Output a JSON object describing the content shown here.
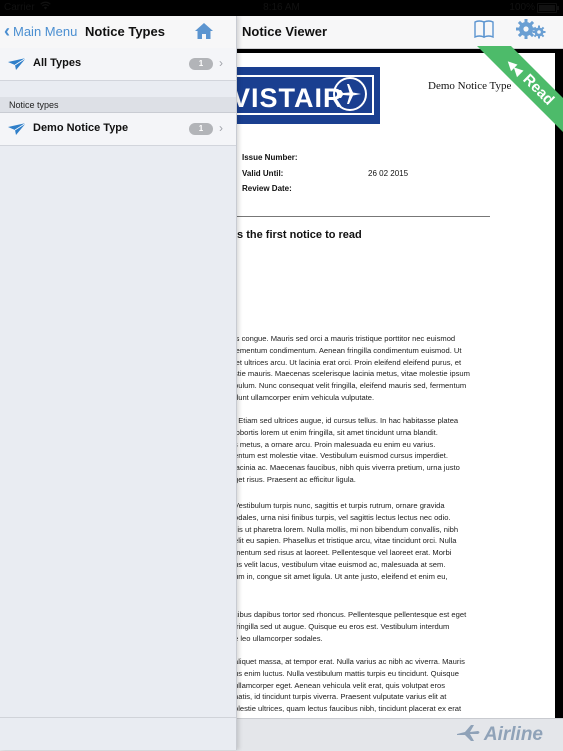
{
  "status": {
    "carrier": "Carrier",
    "time": "8:16 AM",
    "battery": "100%",
    "battery_level": 1.0
  },
  "panel": {
    "back_label": "Main Menu",
    "title": "Notice Types",
    "rows": [
      {
        "label": "All Types",
        "count": "1"
      }
    ],
    "section_header": "Notice types",
    "section_rows": [
      {
        "label": "Demo Notice Type",
        "count": "1"
      }
    ]
  },
  "viewer": {
    "title": "Notice Viewer",
    "ribbon": "Read",
    "brand": "Airline",
    "doc": {
      "logo_text": "VISTAIR",
      "doc_type": "Demo Notice Type",
      "meta": [
        {
          "label": "Issue Number:",
          "value": ""
        },
        {
          "label": "Valid Until:",
          "value": "26 02 2015"
        },
        {
          "label": "Review Date:",
          "value": ""
        }
      ],
      "heading": "is the first notice to read",
      "paragraphs": [
        [
          "is congue. Mauris sed orci a mauris tristique porttitor nec euismod",
          "lementum condimentum. Aenean fringilla condimentum euismod. Ut",
          "let ultrices arcu. Ut lacinia erat orci. Proin eleifend eleifend purus, et",
          "stie mauris. Maecenas scelerisque lacinia metus, vitae molestie ipsum",
          "bulum. Nunc consequat velit fringilla, eleifend mauris sed, fermentum",
          "dunt ullamcorper enim vehicula vulputate."
        ],
        [
          ". Etiam sed ultrices augue, id cursus tellus. In hac habitasse platea",
          "lobortis lorem ut enim fringilla, sit amet tincidunt urna blandit.",
          "s metus, a ornare arcu. Proin malesuada eu enim eu varius.",
          "entum est molestie vitae. Vestibulum euismod cursus imperdiet.",
          "lacinia ac. Maecenas faucibus, nibh quis viverra pretium, urna justo",
          "get risus. Praesent ac efficitur ligula."
        ],
        [
          "Vestibulum turpis nunc, sagittis et turpis rutrum, ornare gravida",
          "odales, urna nisi finibus turpis, vel sagittis lectus lectus nec odio.",
          "llis ut pharetra lorem. Nulla mollis, mi non bibendum convallis, nibh",
          "elit eu sapien. Phasellus et tristique arcu, vitae tincidunt orci. Nulla",
          "mentum sed risus at laoreet. Pellentesque vel laoreet erat. Morbi",
          "us velit lacus, vestibulum vitae euismod ac, malesuada at sem.",
          "um in, congue sit amet ligula. Ut ante justo, eleifend et enim eu,"
        ],
        [
          "cibus dapibus tortor sed rhoncus. Pellentesque pellentesque est eget",
          "fringilla sed ut augue. Quisque eu eros est. Vestibulum interdum",
          "e leo ullamcorper sodales."
        ],
        [
          "aliquet massa, at tempor erat. Nulla varius ac nibh ac viverra. Mauris",
          "us enim luctus. Nulla vestibulum mattis turpis eu tincidunt. Quisque",
          "ullamcorper eget. Aenean vehicula velit erat, quis volutpat eros",
          "natis, id tincidunt turpis viverra. Praesent vulputate varius elit at",
          "olestie ultrices, quam lectus faucibus nibh, tincidunt placerat ex erat"
        ]
      ]
    }
  },
  "colors": {
    "accent": "#4b8fd1",
    "ribbon": "#4dbb6a",
    "logo_bg": "#1a3f90",
    "badge": "#b2b4b8"
  }
}
